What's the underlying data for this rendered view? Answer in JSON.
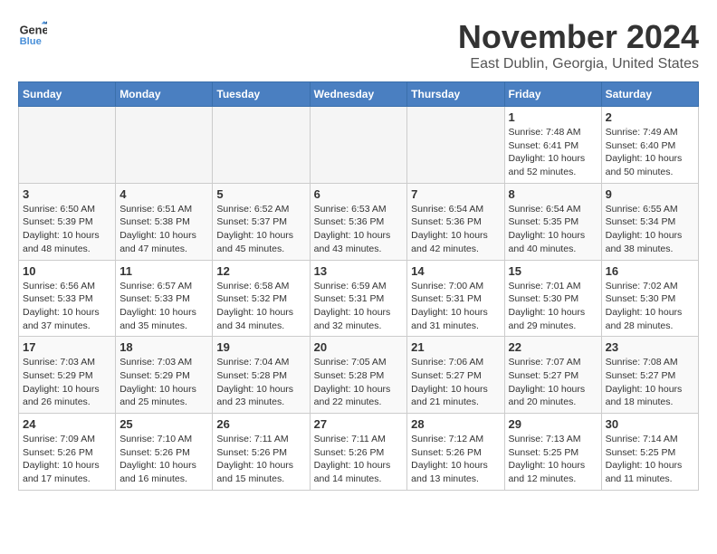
{
  "header": {
    "logo_line1": "General",
    "logo_line2": "Blue",
    "month": "November 2024",
    "location": "East Dublin, Georgia, United States"
  },
  "days_of_week": [
    "Sunday",
    "Monday",
    "Tuesday",
    "Wednesday",
    "Thursday",
    "Friday",
    "Saturday"
  ],
  "weeks": [
    [
      {
        "day": "",
        "info": ""
      },
      {
        "day": "",
        "info": ""
      },
      {
        "day": "",
        "info": ""
      },
      {
        "day": "",
        "info": ""
      },
      {
        "day": "",
        "info": ""
      },
      {
        "day": "1",
        "info": "Sunrise: 7:48 AM\nSunset: 6:41 PM\nDaylight: 10 hours\nand 52 minutes."
      },
      {
        "day": "2",
        "info": "Sunrise: 7:49 AM\nSunset: 6:40 PM\nDaylight: 10 hours\nand 50 minutes."
      }
    ],
    [
      {
        "day": "3",
        "info": "Sunrise: 6:50 AM\nSunset: 5:39 PM\nDaylight: 10 hours\nand 48 minutes."
      },
      {
        "day": "4",
        "info": "Sunrise: 6:51 AM\nSunset: 5:38 PM\nDaylight: 10 hours\nand 47 minutes."
      },
      {
        "day": "5",
        "info": "Sunrise: 6:52 AM\nSunset: 5:37 PM\nDaylight: 10 hours\nand 45 minutes."
      },
      {
        "day": "6",
        "info": "Sunrise: 6:53 AM\nSunset: 5:36 PM\nDaylight: 10 hours\nand 43 minutes."
      },
      {
        "day": "7",
        "info": "Sunrise: 6:54 AM\nSunset: 5:36 PM\nDaylight: 10 hours\nand 42 minutes."
      },
      {
        "day": "8",
        "info": "Sunrise: 6:54 AM\nSunset: 5:35 PM\nDaylight: 10 hours\nand 40 minutes."
      },
      {
        "day": "9",
        "info": "Sunrise: 6:55 AM\nSunset: 5:34 PM\nDaylight: 10 hours\nand 38 minutes."
      }
    ],
    [
      {
        "day": "10",
        "info": "Sunrise: 6:56 AM\nSunset: 5:33 PM\nDaylight: 10 hours\nand 37 minutes."
      },
      {
        "day": "11",
        "info": "Sunrise: 6:57 AM\nSunset: 5:33 PM\nDaylight: 10 hours\nand 35 minutes."
      },
      {
        "day": "12",
        "info": "Sunrise: 6:58 AM\nSunset: 5:32 PM\nDaylight: 10 hours\nand 34 minutes."
      },
      {
        "day": "13",
        "info": "Sunrise: 6:59 AM\nSunset: 5:31 PM\nDaylight: 10 hours\nand 32 minutes."
      },
      {
        "day": "14",
        "info": "Sunrise: 7:00 AM\nSunset: 5:31 PM\nDaylight: 10 hours\nand 31 minutes."
      },
      {
        "day": "15",
        "info": "Sunrise: 7:01 AM\nSunset: 5:30 PM\nDaylight: 10 hours\nand 29 minutes."
      },
      {
        "day": "16",
        "info": "Sunrise: 7:02 AM\nSunset: 5:30 PM\nDaylight: 10 hours\nand 28 minutes."
      }
    ],
    [
      {
        "day": "17",
        "info": "Sunrise: 7:03 AM\nSunset: 5:29 PM\nDaylight: 10 hours\nand 26 minutes."
      },
      {
        "day": "18",
        "info": "Sunrise: 7:03 AM\nSunset: 5:29 PM\nDaylight: 10 hours\nand 25 minutes."
      },
      {
        "day": "19",
        "info": "Sunrise: 7:04 AM\nSunset: 5:28 PM\nDaylight: 10 hours\nand 23 minutes."
      },
      {
        "day": "20",
        "info": "Sunrise: 7:05 AM\nSunset: 5:28 PM\nDaylight: 10 hours\nand 22 minutes."
      },
      {
        "day": "21",
        "info": "Sunrise: 7:06 AM\nSunset: 5:27 PM\nDaylight: 10 hours\nand 21 minutes."
      },
      {
        "day": "22",
        "info": "Sunrise: 7:07 AM\nSunset: 5:27 PM\nDaylight: 10 hours\nand 20 minutes."
      },
      {
        "day": "23",
        "info": "Sunrise: 7:08 AM\nSunset: 5:27 PM\nDaylight: 10 hours\nand 18 minutes."
      }
    ],
    [
      {
        "day": "24",
        "info": "Sunrise: 7:09 AM\nSunset: 5:26 PM\nDaylight: 10 hours\nand 17 minutes."
      },
      {
        "day": "25",
        "info": "Sunrise: 7:10 AM\nSunset: 5:26 PM\nDaylight: 10 hours\nand 16 minutes."
      },
      {
        "day": "26",
        "info": "Sunrise: 7:11 AM\nSunset: 5:26 PM\nDaylight: 10 hours\nand 15 minutes."
      },
      {
        "day": "27",
        "info": "Sunrise: 7:11 AM\nSunset: 5:26 PM\nDaylight: 10 hours\nand 14 minutes."
      },
      {
        "day": "28",
        "info": "Sunrise: 7:12 AM\nSunset: 5:26 PM\nDaylight: 10 hours\nand 13 minutes."
      },
      {
        "day": "29",
        "info": "Sunrise: 7:13 AM\nSunset: 5:25 PM\nDaylight: 10 hours\nand 12 minutes."
      },
      {
        "day": "30",
        "info": "Sunrise: 7:14 AM\nSunset: 5:25 PM\nDaylight: 10 hours\nand 11 minutes."
      }
    ]
  ]
}
